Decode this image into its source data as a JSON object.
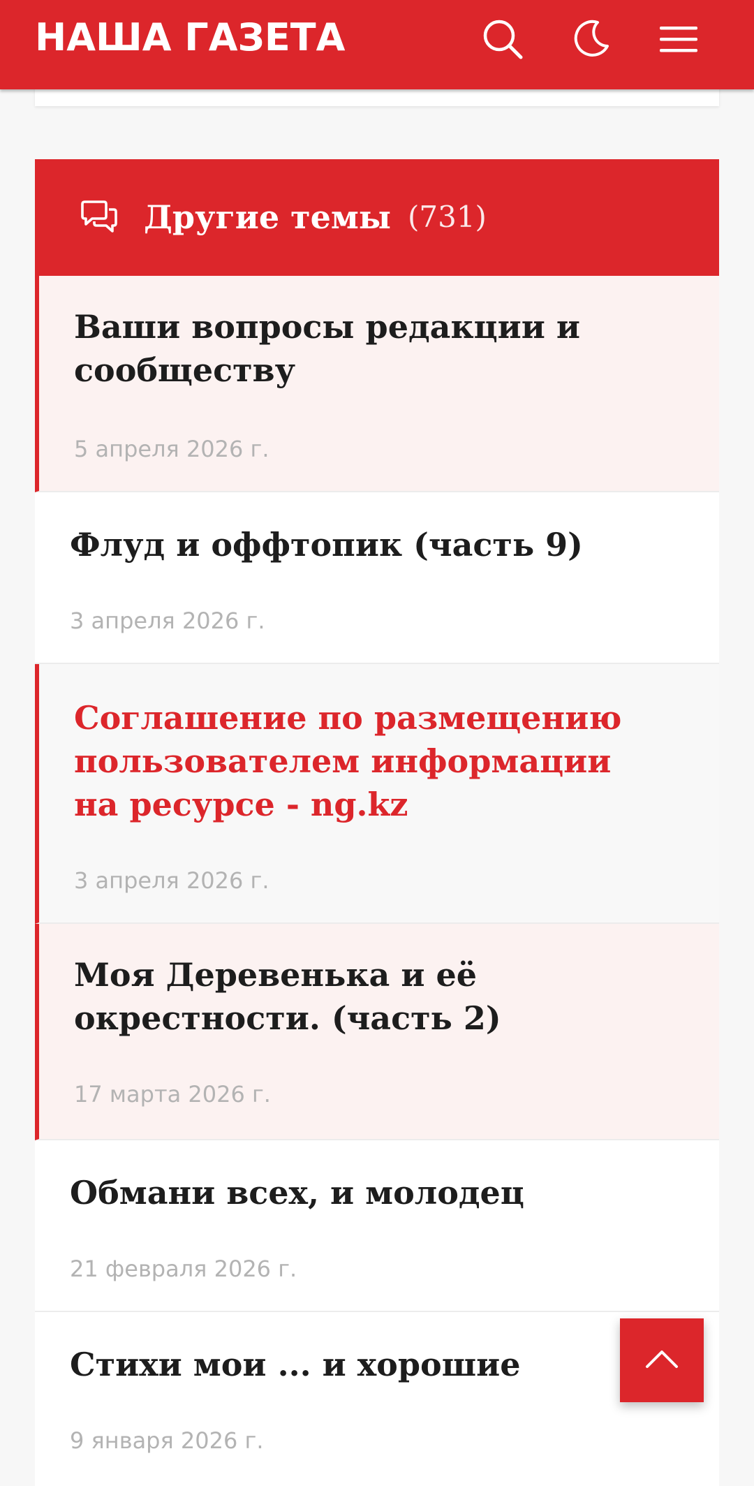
{
  "header": {
    "logo": "НАША ГАЗЕТА",
    "icons": [
      "search-icon",
      "moon-icon",
      "hamburger-menu-icon"
    ],
    "accent_color": "#dc262b"
  },
  "section": {
    "icon": "chat-bubbles-icon",
    "title": "Другие темы",
    "count": "(731)"
  },
  "topics": [
    {
      "title": "Ваши вопросы редакции и сообществу",
      "date": "5 апреля 2026 г.",
      "pinned": true
    },
    {
      "title": "Флуд и оффтопик (часть 9)",
      "date": "3 апреля 2026 г.",
      "pinned": false
    },
    {
      "title": "Соглашение по размещению пользователем информации на ресурсе - ng.kz",
      "date": "3 апреля 2026 г.",
      "pinned": true,
      "highlighted": true
    },
    {
      "title": "Моя Деревенька и её окрестности. (часть 2)",
      "date": "17 марта 2026 г.",
      "pinned": true
    },
    {
      "title": "Обмани всех, и молодец",
      "date": "21 февраля 2026 г.",
      "pinned": false
    },
    {
      "title": "Стихи мои ... и хорошие",
      "date": "9 января 2026 г.",
      "pinned": false
    }
  ],
  "scroll_top": {
    "icon": "chevron-up-icon"
  }
}
